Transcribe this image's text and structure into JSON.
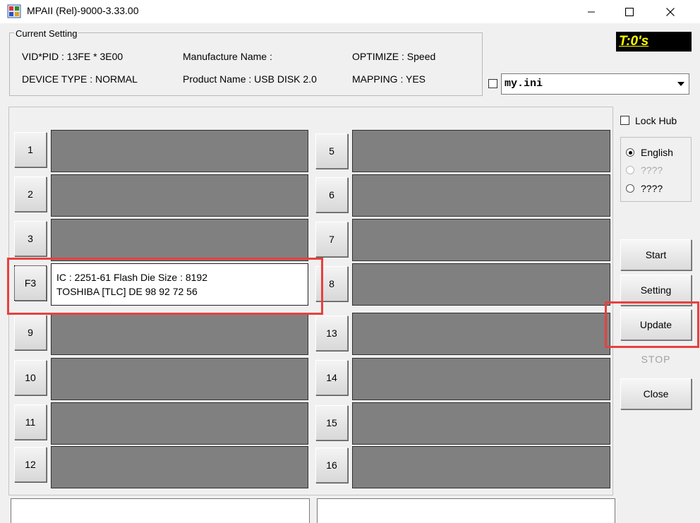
{
  "window": {
    "title": "MPAII (Rel)-9000-3.33.00",
    "icon": "app-icon",
    "controls": [
      "minimize-icon",
      "maximize-icon",
      "close-icon"
    ]
  },
  "current_setting": {
    "legend": "Current Setting",
    "vid_pid": "VID*PID : 13FE * 3E00",
    "manufacture_name": "Manufacture Name :",
    "optimize": "OPTIMIZE : Speed",
    "device_type": "DEVICE TYPE : NORMAL",
    "product_name": "Product Name : USB DISK 2.0",
    "mapping": "MAPPING : YES"
  },
  "timer": {
    "text": "T:0's",
    "bg_color": "#000000",
    "text_color": "#ffff00"
  },
  "ini": {
    "checked": false,
    "value": "my.ini"
  },
  "ports": {
    "left": [
      "1",
      "2",
      "3",
      "F3",
      "9",
      "10",
      "11",
      "12"
    ],
    "right": [
      "5",
      "6",
      "7",
      "8",
      "13",
      "14",
      "15",
      "16"
    ],
    "active": {
      "button": "F3",
      "line1": "IC : 2251-61  Flash Die Size : 8192",
      "line2": "TOSHIBA [TLC] DE 98 92 72 56"
    }
  },
  "lock_hub": {
    "label": "Lock Hub",
    "checked": false
  },
  "language": {
    "options": [
      {
        "label": "English",
        "selected": true,
        "enabled": true
      },
      {
        "label": "????",
        "selected": false,
        "enabled": false
      },
      {
        "label": "????",
        "selected": false,
        "enabled": true
      }
    ]
  },
  "buttons": {
    "start": "Start",
    "setting": "Setting",
    "update": "Update",
    "stop": "STOP",
    "close": "Close"
  },
  "colors": {
    "highlight": "#e8403f",
    "port_bar": "#808080"
  }
}
